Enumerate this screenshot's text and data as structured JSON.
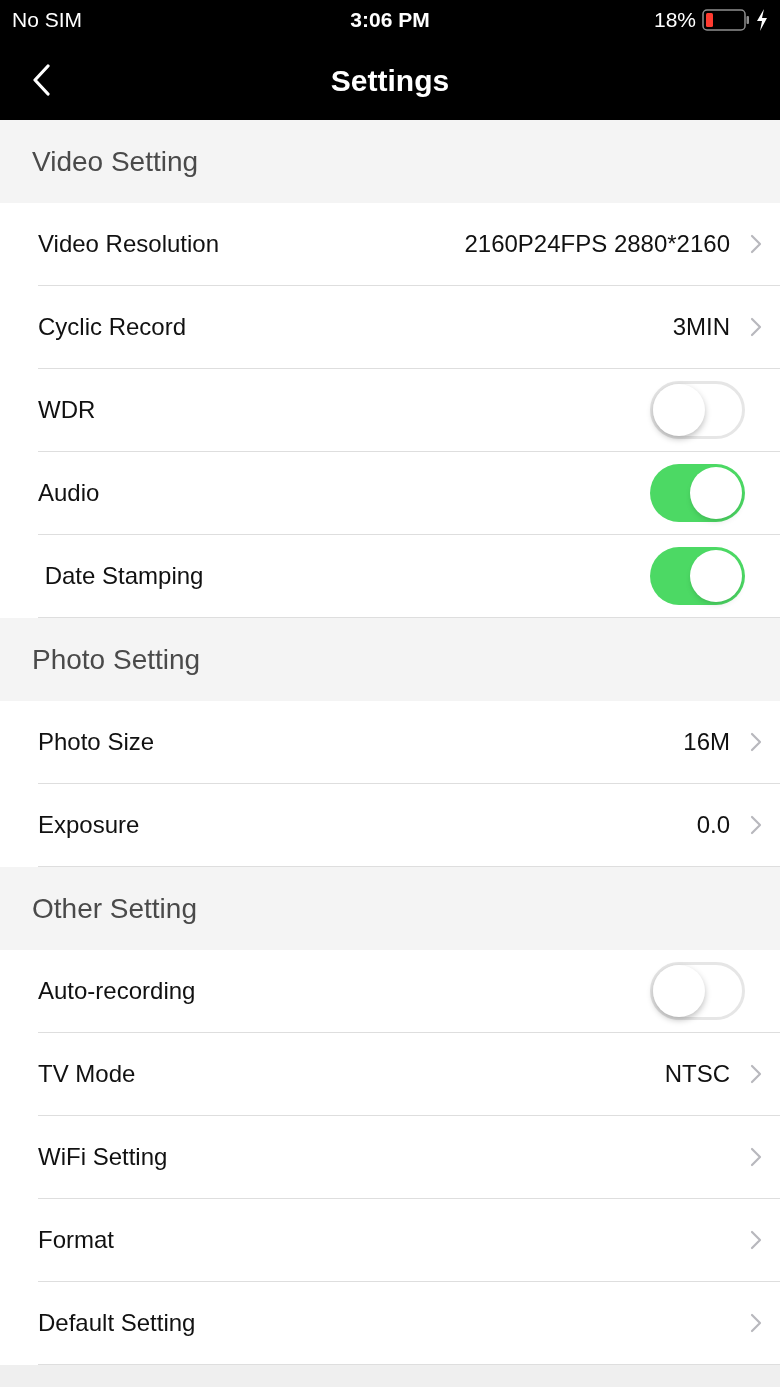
{
  "status_bar": {
    "carrier": "No SIM",
    "time": "3:06 PM",
    "battery": "18%"
  },
  "nav_bar": {
    "title": "Settings"
  },
  "sections": [
    {
      "title": "Video Setting",
      "rows": [
        {
          "kind": "link",
          "label": "Video Resolution",
          "value": "2160P24FPS 2880*2160"
        },
        {
          "kind": "link",
          "label": "Cyclic Record",
          "value": "3MIN"
        },
        {
          "kind": "toggle",
          "label": "WDR",
          "on": false
        },
        {
          "kind": "toggle",
          "label": "Audio",
          "on": true
        },
        {
          "kind": "toggle",
          "label": " Date Stamping",
          "on": true
        }
      ]
    },
    {
      "title": "Photo Setting",
      "rows": [
        {
          "kind": "link",
          "label": "Photo Size",
          "value": "16M"
        },
        {
          "kind": "link",
          "label": "Exposure",
          "value": "0.0"
        }
      ]
    },
    {
      "title": "Other Setting",
      "rows": [
        {
          "kind": "toggle",
          "label": "Auto-recording",
          "on": false
        },
        {
          "kind": "link",
          "label": "TV Mode",
          "value": "NTSC"
        },
        {
          "kind": "link",
          "label": "WiFi Setting"
        },
        {
          "kind": "link",
          "label": "Format"
        },
        {
          "kind": "link",
          "label": "Default Setting"
        }
      ]
    }
  ]
}
